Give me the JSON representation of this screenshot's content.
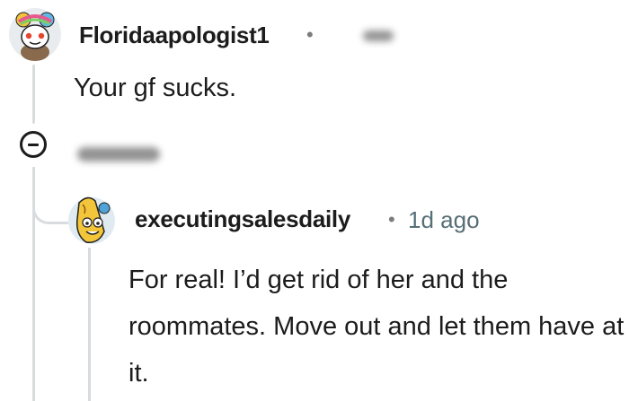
{
  "comment_parent": {
    "username": "Floridaapologist1",
    "separator": "•",
    "body": "Your gf sucks."
  },
  "comment_reply": {
    "username": "executingsalesdaily",
    "separator": "•",
    "timestamp": "1d ago",
    "body": "For real! I’d get rid of her and the roommates. Move out and let them have at it."
  },
  "icons": {
    "collapse": "collapse-thread-icon",
    "avatar_parent": "snoo-avatar-icon",
    "avatar_reply": "banana-avatar-icon"
  },
  "colors": {
    "thread_line": "#d9dcdf",
    "text": "#1c1c1c",
    "meta": "#576f76"
  }
}
